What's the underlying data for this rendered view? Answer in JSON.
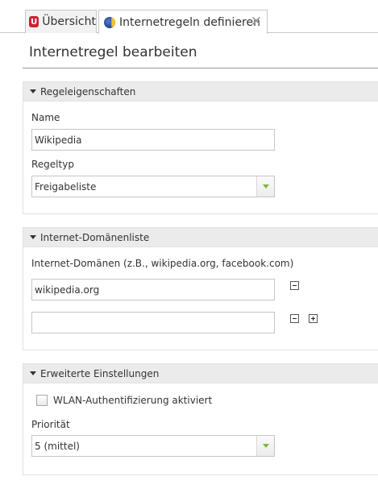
{
  "tabs": [
    {
      "label": "Übersicht",
      "icon": "ub-logo-icon"
    },
    {
      "label": "Internetregeln definieren",
      "icon": "globe-icon",
      "close": "✕"
    }
  ],
  "page_title": "Internetregel bearbeiten",
  "sections": {
    "rule_properties": {
      "title": "Regeleigenschaften",
      "name_label": "Name",
      "name_value": "Wikipedia",
      "type_label": "Regeltyp",
      "type_value": "Freigabeliste"
    },
    "domain_list": {
      "title": "Internet-Domänenliste",
      "domains_label": "Internet-Domänen (z.B., wikipedia.org, facebook.com)",
      "domains": [
        "wikipedia.org",
        ""
      ]
    },
    "advanced": {
      "title": "Erweiterte Einstellungen",
      "wlan_label": "WLAN-Authentifizierung aktiviert",
      "wlan_checked": false,
      "priority_label": "Priorität",
      "priority_value": "5 (mittel)"
    }
  },
  "colors": {
    "brand_red": "#d02033",
    "select_arrow": "#7bb83a",
    "section_header_bg": "#ebebeb"
  }
}
